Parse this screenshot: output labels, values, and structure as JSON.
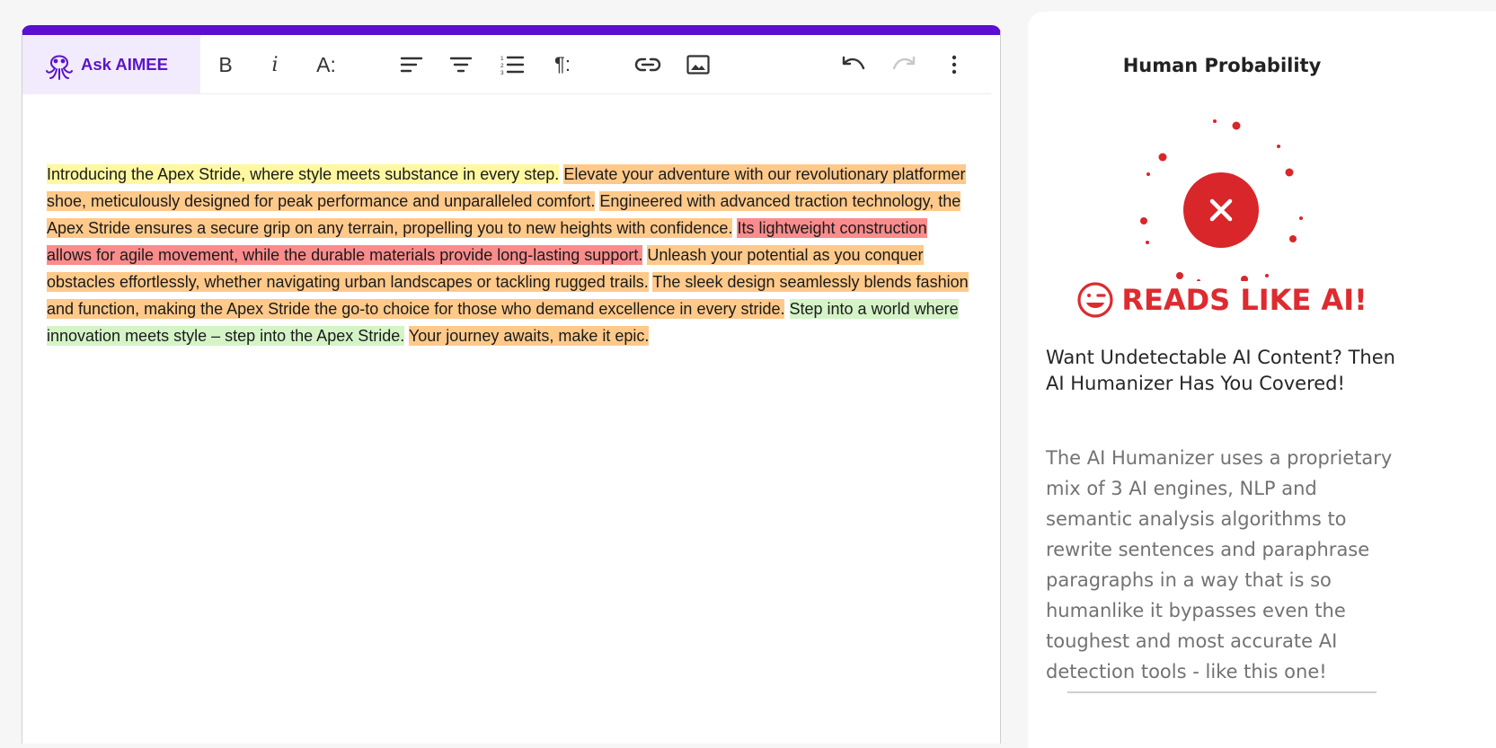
{
  "toolbar": {
    "ask_label": "Ask AIMEE",
    "bold_label": "B",
    "italic_label": "i",
    "font_size_label": "A:",
    "paragraph_label": "¶:",
    "icons": [
      "octopus-icon",
      "bold-icon",
      "italic-icon",
      "font-size-icon",
      "align-left-icon",
      "align-center-icon",
      "numbered-list-icon",
      "paragraph-icon",
      "link-icon",
      "image-icon",
      "undo-icon",
      "redo-icon",
      "more-vertical-icon"
    ]
  },
  "colors": {
    "accent": "#5b0fd0",
    "ask_bg": "#f2ebfd",
    "highlight_yellow": "#fff8a0",
    "highlight_orange": "#ffc98a",
    "highlight_red": "#fb8c8c",
    "highlight_green": "#d4f4c7",
    "verdict_red": "#dd2b30"
  },
  "editor": {
    "sentences": [
      {
        "text": "Introducing the Apex Stride, where style meets substance in every step.",
        "highlight": "yellow"
      },
      {
        "text": "Elevate your adventure with our revolutionary platformer shoe, meticulously designed for peak performance and unparalleled comfort.",
        "highlight": "orange"
      },
      {
        "text": "Engineered with advanced traction technology, the Apex Stride ensures a secure grip on any terrain, propelling you to new heights with confidence.",
        "highlight": "orange"
      },
      {
        "text": "Its lightweight construction allows for agile movement, while the durable materials provide long-lasting support.",
        "highlight": "red"
      },
      {
        "text": "Unleash your potential as you conquer obstacles effortlessly, whether navigating urban landscapes or tackling rugged trails.",
        "highlight": "orange"
      },
      {
        "text": "The sleek design seamlessly blends fashion and function, making the Apex Stride the go-to choice for those who demand excellence in every stride.",
        "highlight": "orange"
      },
      {
        "text": "Step into a world where innovation meets style – step into the Apex Stride.",
        "highlight": "green"
      },
      {
        "text": "Your journey awaits, make it epic.",
        "highlight": "orange"
      }
    ]
  },
  "side_panel": {
    "title": "Human Probability",
    "verdict": "READS LIKE AI!",
    "verdict_icon": "winking-face-icon",
    "gauge_icon": "close-icon",
    "promo_heading": "Want Undetectable AI Content? Then AI Humanizer Has You Covered!",
    "promo_body": "The AI Humanizer uses a proprietary mix of 3 AI engines, NLP and semantic analysis algorithms to rewrite sentences and paraphrase paragraphs in a way that is so humanlike it bypasses even the toughest and most accurate AI detection tools - like this one!"
  }
}
